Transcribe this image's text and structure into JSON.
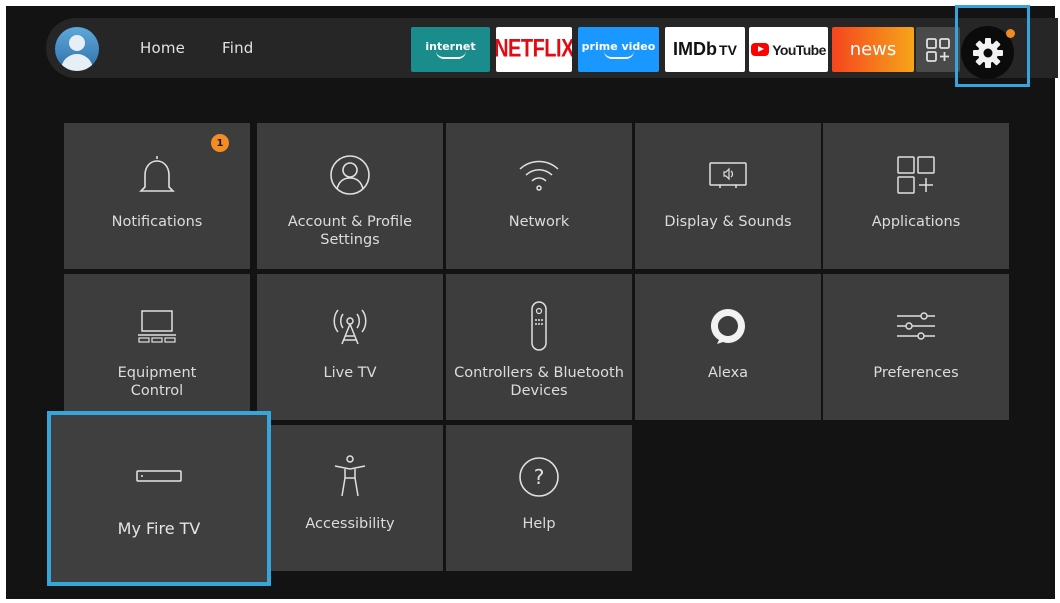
{
  "colors": {
    "background": "#131313",
    "tile": "#3d3d3d",
    "focus_outline": "#36a5dc",
    "badge": "#f28c23",
    "icon_stroke": "#e0e0e0"
  },
  "nav": {
    "avatar_icon": "profile-avatar-icon",
    "home": "Home",
    "find": "Find"
  },
  "apps": {
    "internet": "internet",
    "netflix": "NETFLIX",
    "prime": "prime video",
    "imdb_main": "IMDb",
    "imdb_tv": "TV",
    "youtube": "YouTube",
    "news": "news",
    "grid_icon": "app-grid-icon",
    "settings_icon": "gear-icon"
  },
  "settings": {
    "notifications": {
      "label": "Notifications",
      "icon": "bell-icon",
      "badge": "1"
    },
    "account": {
      "label": "Account & Profile\nSettings",
      "icon": "person-circle-icon"
    },
    "network": {
      "label": "Network",
      "icon": "wifi-icon"
    },
    "display": {
      "label": "Display & Sounds",
      "icon": "tv-speaker-icon"
    },
    "applications": {
      "label": "Applications",
      "icon": "apps-grid-icon"
    },
    "equipment": {
      "label": "Equipment\nControl",
      "icon": "equipment-icon"
    },
    "livetv": {
      "label": "Live TV",
      "icon": "broadcast-antenna-icon"
    },
    "controllers": {
      "label": "Controllers & Bluetooth\nDevices",
      "icon": "remote-icon"
    },
    "alexa": {
      "label": "Alexa",
      "icon": "alexa-ring-icon"
    },
    "preferences": {
      "label": "Preferences",
      "icon": "sliders-icon"
    },
    "myfiretv": {
      "label": "My Fire TV",
      "icon": "fire-tv-device-icon"
    },
    "accessibility": {
      "label": "Accessibility",
      "icon": "accessibility-figure-icon"
    },
    "help": {
      "label": "Help",
      "icon": "question-circle-icon",
      "glyph": "?"
    }
  }
}
